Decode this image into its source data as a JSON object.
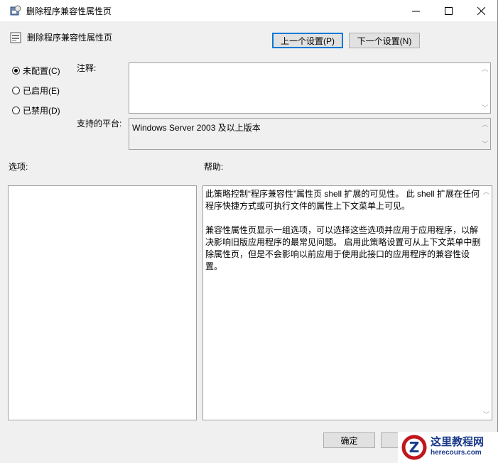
{
  "window": {
    "title": "删除程序兼容性属性页",
    "header": "删除程序兼容性属性页"
  },
  "nav": {
    "prev_label": "上一个设置(P)",
    "next_label": "下一个设置(N)"
  },
  "state": {
    "options": [
      {
        "label": "未配置(C)",
        "selected": true
      },
      {
        "label": "已启用(E)",
        "selected": false
      },
      {
        "label": "已禁用(D)",
        "selected": false
      }
    ]
  },
  "fields": {
    "comment_label": "注释:",
    "comment_value": "",
    "platform_label": "支持的平台:",
    "platform_value": "Windows Server 2003 及以上版本"
  },
  "panels": {
    "options_label": "选项:",
    "help_label": "帮助:",
    "help_paragraphs": [
      "此策略控制“程序兼容性”属性页 shell 扩展的可见性。 此 shell 扩展在任何程序快捷方式或可执行文件的属性上下文菜单上可见。",
      "兼容性属性页显示一组选项，可以选择这些选项并应用于应用程序，以解决影响旧版应用程序的最常见问题。 启用此策略设置可从上下文菜单中删除属性页，但是不会影响以前应用于使用此接口的应用程序的兼容性设置。"
    ]
  },
  "footer": {
    "ok_label": "确定",
    "cancel_label": ""
  },
  "watermark": {
    "cn": "这里教程网",
    "en": "herecours.com"
  },
  "colors": {
    "accent": "#0078d7",
    "watermark": "#1a3a8a"
  }
}
